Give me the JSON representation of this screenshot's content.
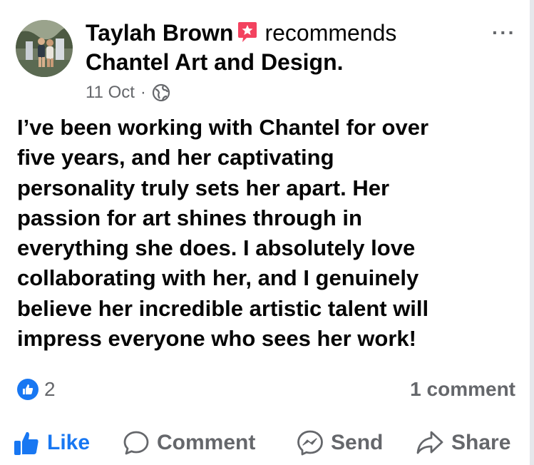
{
  "post": {
    "author": "Taylah Brown",
    "action": "recommends",
    "page_name": "Chantel Art and Design.",
    "date": "11 Oct",
    "separator": "·",
    "more_label": "···",
    "body_lines": [
      "I’ve been working with Chantel for over",
      "five years, and her captivating",
      "personality truly sets her apart. Her",
      "passion for art shines through in",
      "everything she does. I absolutely love",
      "collaborating with her, and I genuinely",
      "believe her incredible artistic talent will",
      "impress everyone who sees her work!"
    ]
  },
  "stats": {
    "reaction_count": "2",
    "comment_count": "1 comment"
  },
  "actions": {
    "like": "Like",
    "comment": "Comment",
    "send": "Send",
    "share": "Share"
  },
  "colors": {
    "accent": "#1877f2",
    "recommend_badge": "#f3425f",
    "secondary_text": "#65676b"
  },
  "icons": {
    "recommend": "recommend-star-icon",
    "audience": "globe-icon",
    "reaction": "like-thumb-icon",
    "like_action": "like-thumb-icon",
    "comment_action": "speech-bubble-icon",
    "send_action": "messenger-icon",
    "share_action": "share-arrow-icon"
  }
}
